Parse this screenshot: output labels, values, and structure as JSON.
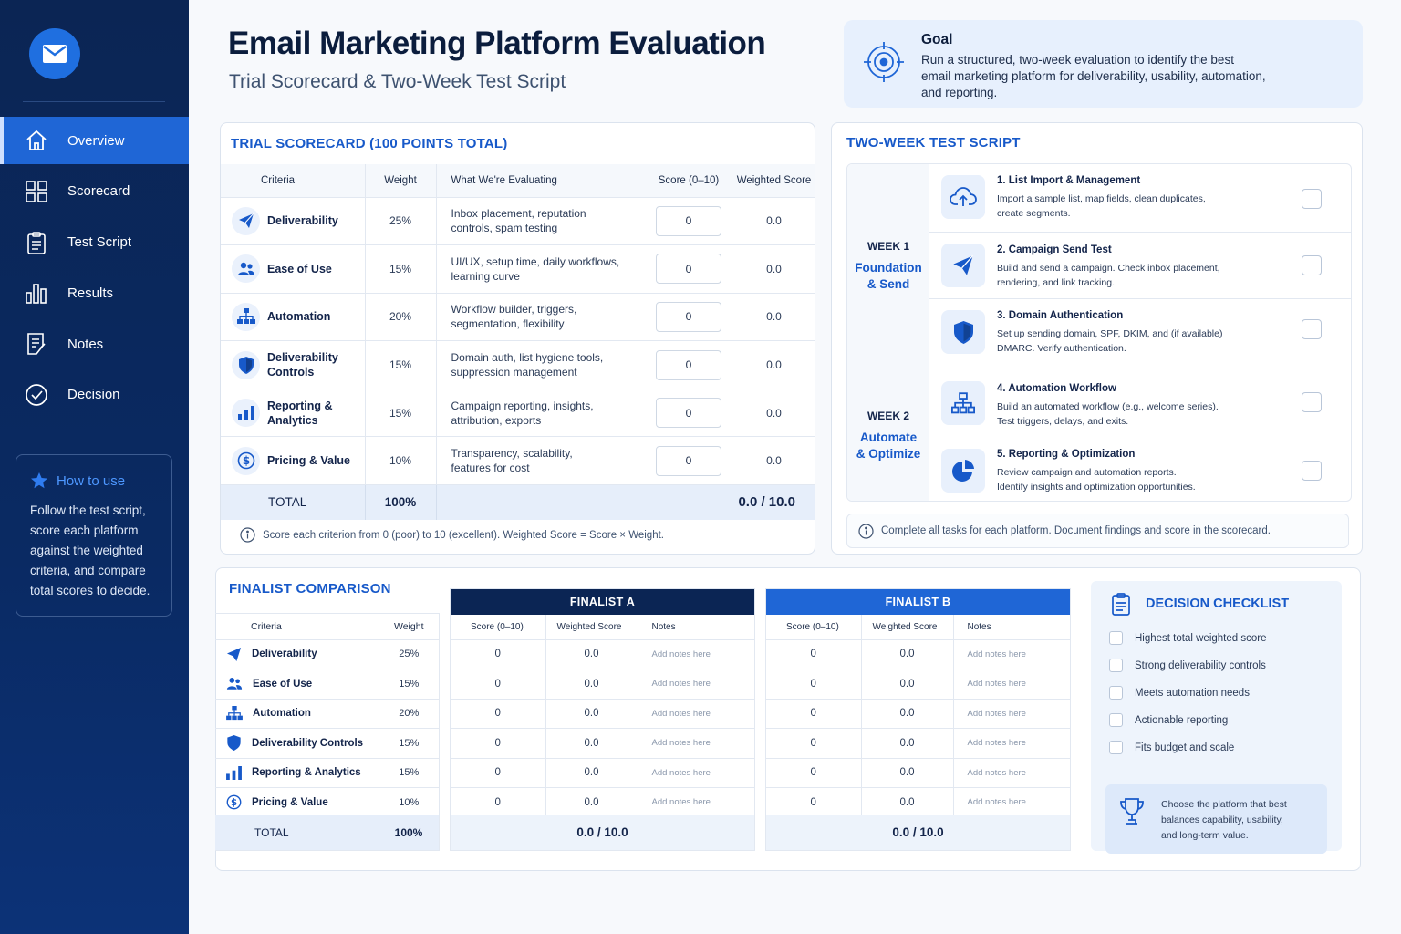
{
  "colors": {
    "sidebar": "#0b2554",
    "accent": "#1f66d6",
    "finalist_a": "#0b2554",
    "finalist_b": "#1f66d6"
  },
  "sidebar": {
    "logo_icon": "mail-icon",
    "items": [
      {
        "label": "Overview",
        "icon": "home-icon",
        "active": true
      },
      {
        "label": "Scorecard",
        "icon": "grid-icon"
      },
      {
        "label": "Test Script",
        "icon": "clipboard-icon"
      },
      {
        "label": "Results",
        "icon": "bar-chart-icon"
      },
      {
        "label": "Notes",
        "icon": "notes-icon"
      },
      {
        "label": "Decision",
        "icon": "check-circle-icon"
      }
    ],
    "howto": {
      "title": "How to use",
      "line1": "Follow the test script,",
      "line2": "score each platform",
      "line3": "against the weighted",
      "line4": "criteria, and compare",
      "line5": "total scores to decide."
    }
  },
  "header": {
    "title": "Email Marketing Platform Evaluation",
    "subtitle": "Trial Scorecard & Two-Week Test Script"
  },
  "goal": {
    "title": "Goal",
    "line1": "Run a structured, two-week evaluation to identify the best",
    "line2": "email marketing platform for deliverability, usability, automation,",
    "line3": "and reporting."
  },
  "scorecard": {
    "title": "TRIAL SCORECARD (100 POINTS TOTAL)",
    "headers": {
      "criteria": "Criteria",
      "weight": "Weight",
      "evaluating": "What We're Evaluating",
      "score": "Score (0–10)",
      "weighted": "Weighted Score"
    },
    "rows": [
      {
        "name": "Deliverability",
        "name2": "",
        "weight": "25%",
        "eval1": "Inbox placement, reputation",
        "eval2": "controls, spam testing",
        "score": "0",
        "weighted": "0.0"
      },
      {
        "name": "Ease of Use",
        "name2": "",
        "weight": "15%",
        "eval1": "UI/UX, setup time, daily workflows,",
        "eval2": "learning curve",
        "score": "0",
        "weighted": "0.0"
      },
      {
        "name": "Automation",
        "name2": "",
        "weight": "20%",
        "eval1": "Workflow builder, triggers,",
        "eval2": "segmentation, flexibility",
        "score": "0",
        "weighted": "0.0"
      },
      {
        "name": "Deliverability",
        "name2": "Controls",
        "weight": "15%",
        "eval1": "Domain auth, list hygiene tools,",
        "eval2": "suppression management",
        "score": "0",
        "weighted": "0.0"
      },
      {
        "name": "Reporting &",
        "name2": "Analytics",
        "weight": "15%",
        "eval1": "Campaign reporting, insights,",
        "eval2": "attribution, exports",
        "score": "0",
        "weighted": "0.0"
      },
      {
        "name": "Pricing & Value",
        "name2": "",
        "weight": "10%",
        "eval1": "Transparency, scalability,",
        "eval2": "features for cost",
        "score": "0",
        "weighted": "0.0"
      }
    ],
    "total_label": "TOTAL",
    "total_weight": "100%",
    "total_score": "0.0 / 10.0",
    "note": "Score each criterion from 0 (poor) to 10 (excellent). Weighted Score = Score × Weight."
  },
  "test_script": {
    "title": "TWO-WEEK TEST SCRIPT",
    "week1": {
      "label": "WEEK 1",
      "name1": "Foundation",
      "name2": "& Send"
    },
    "week2": {
      "label": "WEEK 2",
      "name1": "Automate",
      "name2": "& Optimize"
    },
    "tasks": [
      {
        "title": "1. List Import & Management",
        "desc1": "Import a sample list, map fields, clean duplicates,",
        "desc2": "create segments.",
        "icon": "cloud-upload-icon"
      },
      {
        "title": "2.  Campaign Send Test",
        "desc1": "Build and send a campaign. Check inbox placement,",
        "desc2": "rendering, and link tracking.",
        "icon": "paper-plane-icon"
      },
      {
        "title": "3.  Domain Authentication",
        "desc1": "Set up sending domain, SPF, DKIM, and (if available)",
        "desc2": "DMARC. Verify authentication.",
        "icon": "shield-icon"
      },
      {
        "title": "4.  Automation Workflow",
        "desc1": "Build an automated workflow (e.g., welcome series).",
        "desc2": "Test triggers, delays, and exits.",
        "icon": "workflow-icon"
      },
      {
        "title": "5.  Reporting & Optimization",
        "desc1": "Review campaign and automation reports.",
        "desc2": "Identify insights and optimization opportunities.",
        "icon": "pie-chart-icon"
      }
    ],
    "note": "Complete all tasks for each platform. Document findings and score in the scorecard."
  },
  "finalist": {
    "title": "FINALIST COMPARISON",
    "headers": {
      "criteria": "Criteria",
      "weight": "Weight",
      "score": "Score (0–10)",
      "weighted": "Weighted Score",
      "notes": "Notes"
    },
    "rows": [
      {
        "name": "Deliverability",
        "weight": "25%"
      },
      {
        "name": "Ease of Use",
        "weight": "15%"
      },
      {
        "name": "Automation",
        "weight": "20%"
      },
      {
        "name": "Deliverability Controls",
        "weight": "15%"
      },
      {
        "name": "Reporting & Analytics",
        "weight": "15%"
      },
      {
        "name": "Pricing & Value",
        "weight": "10%"
      }
    ],
    "total_label": "TOTAL",
    "total_weight": "100%",
    "a": {
      "name": "FINALIST A",
      "rows": [
        {
          "score": "0",
          "weighted": "0.0",
          "notes": "Add notes here"
        },
        {
          "score": "0",
          "weighted": "0.0",
          "notes": "Add notes here"
        },
        {
          "score": "0",
          "weighted": "0.0",
          "notes": "Add notes here"
        },
        {
          "score": "0",
          "weighted": "0.0",
          "notes": "Add notes here"
        },
        {
          "score": "0",
          "weighted": "0.0",
          "notes": "Add notes here"
        },
        {
          "score": "0",
          "weighted": "0.0",
          "notes": "Add notes here"
        }
      ],
      "total": "0.0 / 10.0"
    },
    "b": {
      "name": "FINALIST B",
      "rows": [
        {
          "score": "0",
          "weighted": "0.0",
          "notes": "Add notes here"
        },
        {
          "score": "0",
          "weighted": "0.0",
          "notes": "Add notes here"
        },
        {
          "score": "0",
          "weighted": "0.0",
          "notes": "Add notes here"
        },
        {
          "score": "0",
          "weighted": "0.0",
          "notes": "Add notes here"
        },
        {
          "score": "0",
          "weighted": "0.0",
          "notes": "Add notes here"
        },
        {
          "score": "0",
          "weighted": "0.0",
          "notes": "Add notes here"
        }
      ],
      "total": "0.0 / 10.0"
    }
  },
  "decision": {
    "title": "DECISION CHECKLIST",
    "items": [
      "Highest total weighted score",
      "Strong deliverability controls",
      "Meets automation needs",
      "Actionable reporting",
      "Fits budget and scale"
    ],
    "footer1": "Choose the platform that best",
    "footer2": "balances capability, usability,",
    "footer3": "and long-term value."
  }
}
